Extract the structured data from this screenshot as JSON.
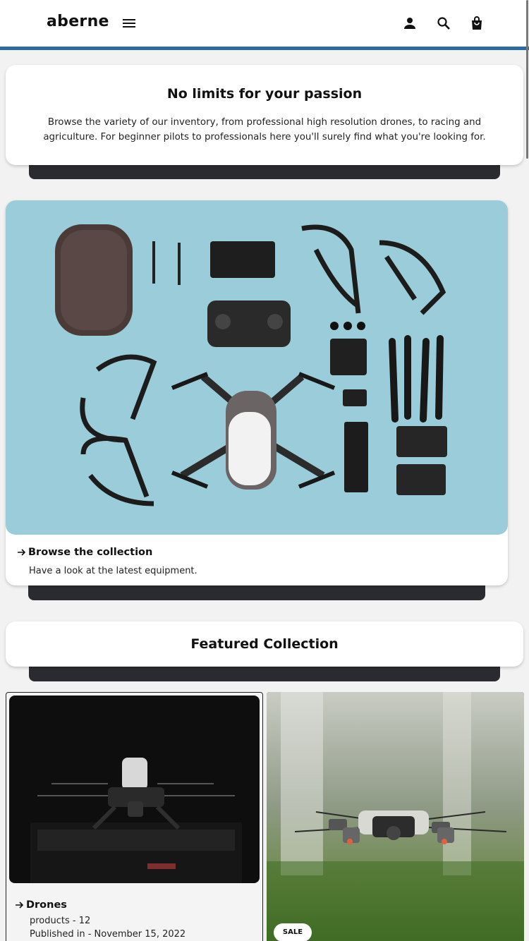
{
  "header": {
    "logo": "aberne",
    "icons": [
      "menu-icon",
      "account-icon",
      "search-icon",
      "bag-icon"
    ],
    "accent_color": "#2d6a9f"
  },
  "hero": {
    "title": "No limits for your passion",
    "text": "Browse the variety of our inventory, from professional high resolution drones, to racing and agriculture. For beginner pilots to professionals here you'll surely find what you're looking for."
  },
  "collection": {
    "link": "Browse the collection",
    "subtitle": "Have a look at the latest equipment."
  },
  "featured": {
    "title": "Featured Collection",
    "items": [
      {
        "title": "Drones",
        "products": "products - 12",
        "published": "Published in - November 15, 2022"
      },
      {
        "badge": "SALE"
      }
    ]
  }
}
